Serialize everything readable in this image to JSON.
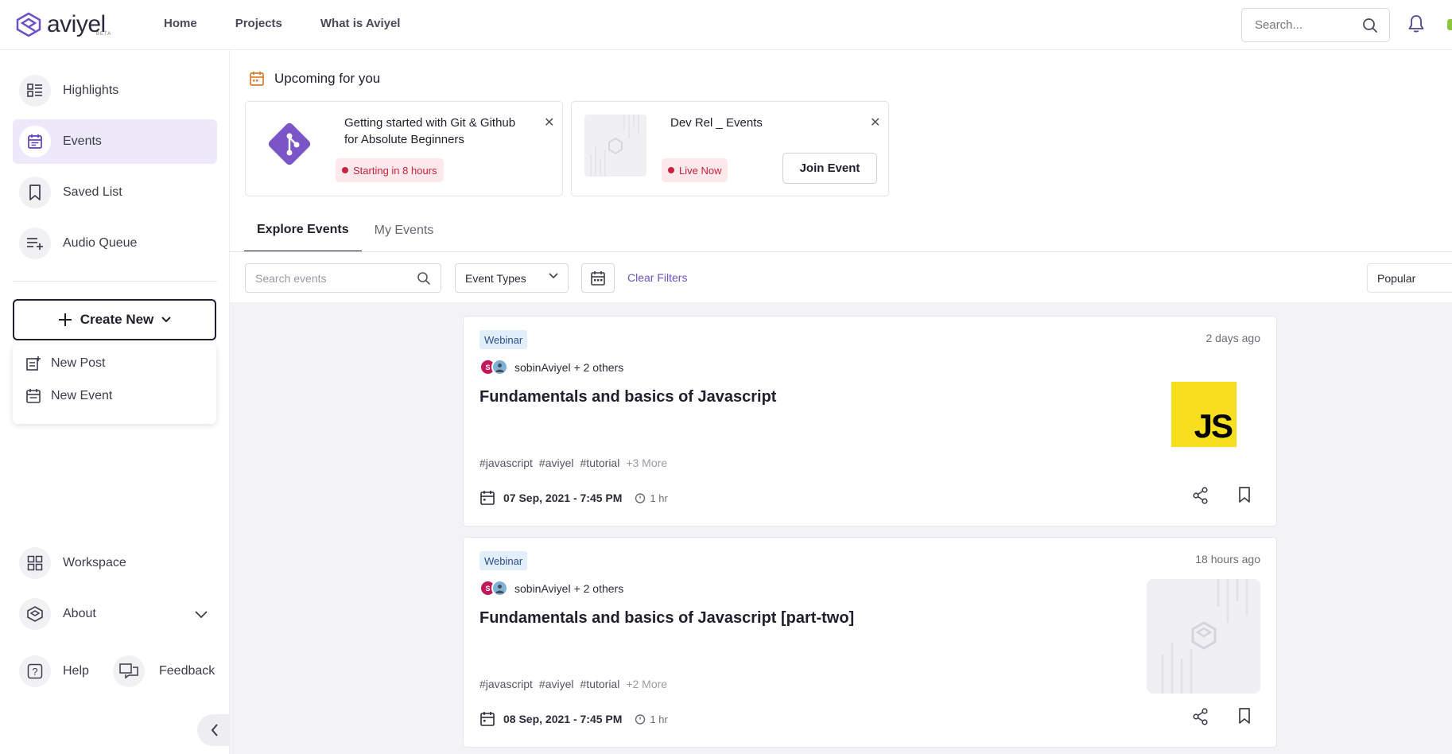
{
  "brand": {
    "name": "aviyel",
    "beta": "BETA"
  },
  "nav": [
    "Home",
    "Projects",
    "What is Aviyel"
  ],
  "search": {
    "placeholder": "Search..."
  },
  "sidebar": {
    "items": [
      {
        "label": "Highlights",
        "icon": "highlights-icon"
      },
      {
        "label": "Events",
        "icon": "calendar-icon",
        "active": true
      },
      {
        "label": "Saved List",
        "icon": "bookmark-icon"
      },
      {
        "label": "Audio Queue",
        "icon": "queue-icon"
      }
    ],
    "create_label": "Create New",
    "create_menu": [
      "New Post",
      "New Event"
    ],
    "workspace": "Workspace",
    "about": "About",
    "help": "Help",
    "feedback": "Feedback"
  },
  "upcoming": {
    "title": "Upcoming for you",
    "cards": [
      {
        "title_line1": "Getting started with Git & Github",
        "title_line2": "for Absolute Beginners",
        "status": "Starting in 8 hours"
      },
      {
        "title_line1": "Dev Rel _ Events",
        "status": "Live Now",
        "action": "Join Event"
      }
    ]
  },
  "tabs": [
    "Explore Events",
    "My Events"
  ],
  "filters": {
    "search_placeholder": "Search events",
    "event_types": "Event Types",
    "clear": "Clear Filters",
    "sort": "Popular"
  },
  "events": [
    {
      "type": "Webinar",
      "time_ago": "2 days ago",
      "host": "sobinAviyel",
      "others": "+ 2 others",
      "title": "Fundamentals and basics of Javascript",
      "tags": [
        "#javascript",
        "#aviyel",
        "#tutorial"
      ],
      "more": "+3 More",
      "date": "07 Sep, 2021 - 7:45 PM",
      "duration": "1 hr",
      "image": "JS"
    },
    {
      "type": "Webinar",
      "time_ago": "18 hours ago",
      "host": "sobinAviyel",
      "others": "+ 2 others",
      "title": "Fundamentals and basics of Javascript [part-two]",
      "tags": [
        "#javascript",
        "#aviyel",
        "#tutorial"
      ],
      "more": "+2 More",
      "date": "08 Sep, 2021 - 7:45 PM",
      "duration": "1 hr"
    }
  ],
  "colors": {
    "accent": "#6b52c6",
    "active_bg": "#ede9fb",
    "status": "#c8223d",
    "js_yellow": "#f7df1e"
  }
}
